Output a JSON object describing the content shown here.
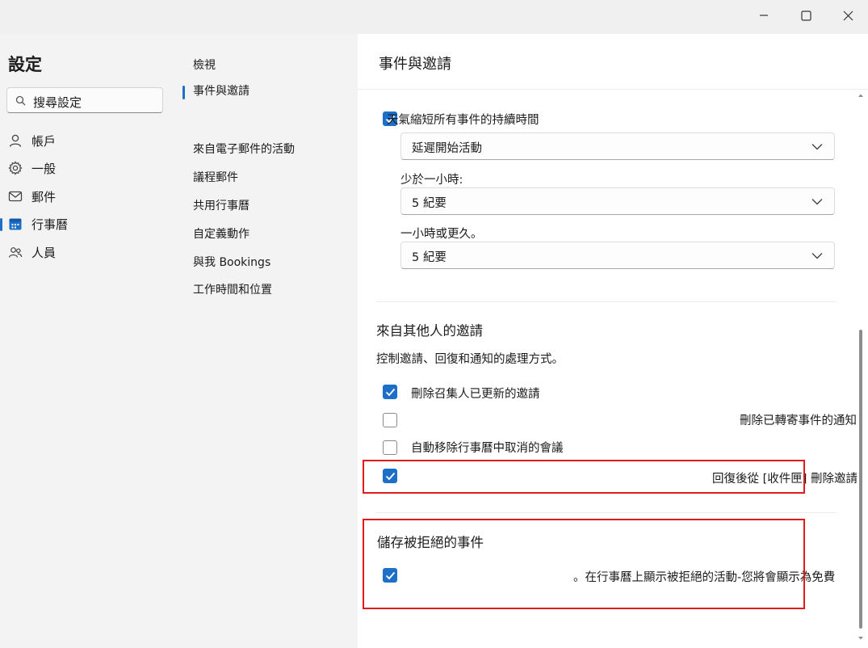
{
  "window": {
    "minimize_icon": "minimize-icon",
    "maximize_icon": "maximize-icon",
    "close_icon": "close-icon"
  },
  "sidebar": {
    "title": "設定",
    "search": {
      "placeholder": "搜尋設定",
      "icon": "search-icon"
    },
    "items": [
      {
        "label": "帳戶",
        "icon": "person-icon",
        "selected": false
      },
      {
        "label": "一般",
        "icon": "gear-icon",
        "selected": false
      },
      {
        "label": "郵件",
        "icon": "mail-icon",
        "selected": false
      },
      {
        "label": "行事曆",
        "icon": "calendar-icon",
        "selected": true
      },
      {
        "label": "人員",
        "icon": "people-icon",
        "selected": false
      }
    ]
  },
  "subnav": {
    "items": [
      {
        "label": "檢視",
        "selected": false
      },
      {
        "label": "事件與邀請",
        "selected": true
      },
      {
        "label": "來自電子郵件的活動",
        "selected": false
      },
      {
        "label": "議程郵件",
        "selected": false
      },
      {
        "label": "共用行事曆",
        "selected": false
      },
      {
        "label": "自定義動作",
        "selected": false
      },
      {
        "label": "與我 Bookings",
        "selected": false
      },
      {
        "label": "工作時間和位置",
        "selected": false
      }
    ]
  },
  "main": {
    "title": "事件與邀請",
    "shorten": {
      "checkbox_label": "天氣縮短所有事件的持續時間",
      "checked": true,
      "mode_select": "延遲開始活動",
      "less_than_hour_label": "少於一小時:",
      "less_than_hour_value": "5 紀要",
      "hour_or_more_label": "一小時或更久。",
      "hour_or_more_value": "5 紀要"
    },
    "invitations": {
      "heading": "來自其他人的邀請",
      "description": "控制邀請、回復和通知的處理方式。",
      "options": [
        {
          "label": "刪除召集人已更新的邀請",
          "checked": true
        },
        {
          "label": "刪除已轉寄事件的通知",
          "checked": false
        },
        {
          "label": "自動移除行事曆中取消的會議",
          "checked": false
        },
        {
          "label": "回復後從 [收件匣] 刪除邀請",
          "checked": true
        }
      ]
    },
    "declined": {
      "heading": "儲存被拒絕的事件",
      "options": [
        {
          "label": "。在行事曆上顯示被拒絕的活動-您將會顯示為免費",
          "checked": true
        }
      ]
    }
  },
  "colors": {
    "accent": "#1d6fc8",
    "highlight_box": "#e01b1b",
    "panel_bg": "#ffffff",
    "window_bg": "#f3f3f3"
  }
}
